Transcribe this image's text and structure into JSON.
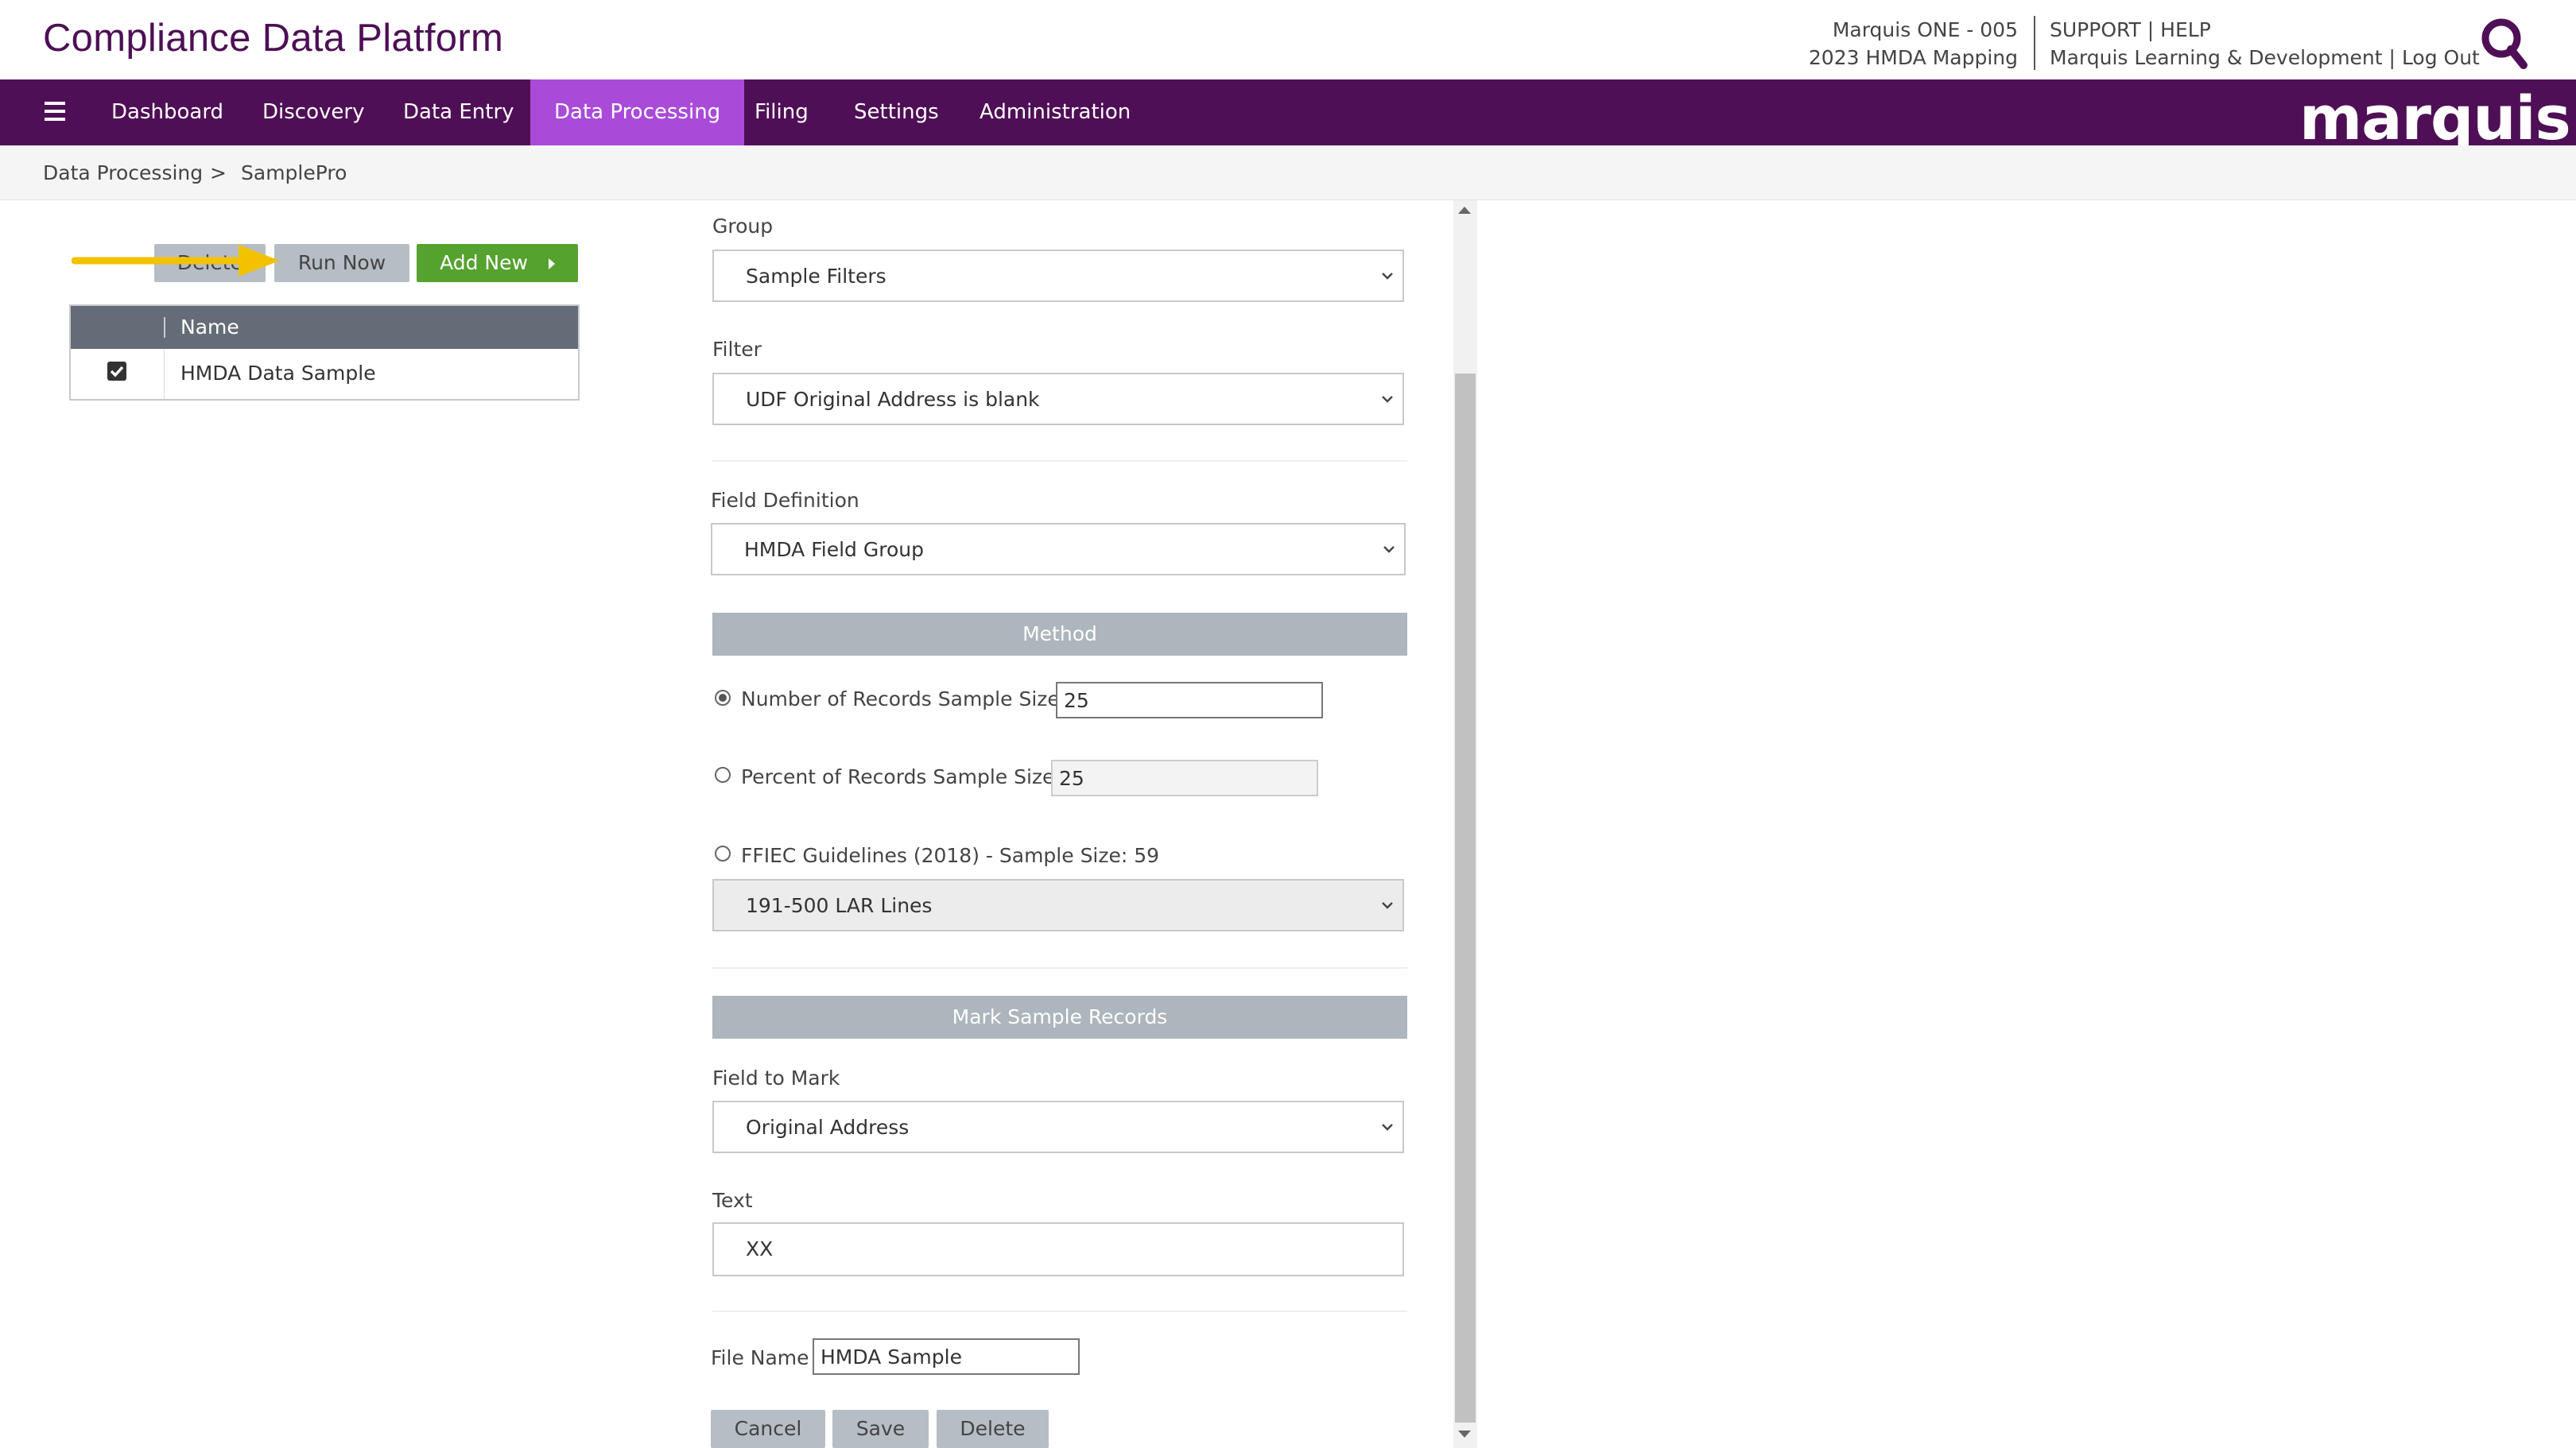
{
  "header": {
    "app_title": "Compliance Data Platform",
    "account_line1": "Marquis ONE - 005",
    "account_line2": "2023 HMDA Mapping",
    "support": "SUPPORT",
    "help": "HELP",
    "org": "Marquis Learning & Development",
    "logout": "Log Out",
    "separator": "|",
    "search_icon": "search-icon"
  },
  "nav": {
    "menu_icon": "hamburger-menu-icon",
    "items": [
      {
        "label": "Dashboard"
      },
      {
        "label": "Discovery"
      },
      {
        "label": "Data Entry"
      },
      {
        "label": "Data Processing"
      },
      {
        "label": "Filing"
      },
      {
        "label": "Settings"
      },
      {
        "label": "Administration"
      }
    ],
    "active_index": 3,
    "brand": "marquis"
  },
  "breadcrumb": {
    "items": [
      "Data Processing",
      "SamplePro"
    ],
    "separator": ">"
  },
  "left_panel": {
    "buttons": {
      "delete": "Delete",
      "run_now": "Run Now",
      "add_new": "Add New"
    },
    "table": {
      "header": "Name",
      "rows": [
        {
          "checked": true,
          "name": "HMDA Data Sample"
        }
      ]
    }
  },
  "form": {
    "group": {
      "label": "Group",
      "value": "Sample Filters"
    },
    "filter": {
      "label": "Filter",
      "value": "UDF Original Address is blank"
    },
    "field_definition": {
      "label": "Field Definition",
      "value": "HMDA Field Group"
    },
    "method": {
      "title": "Method",
      "number_option": {
        "label": "Number of Records Sample Size",
        "value": "25",
        "selected": true
      },
      "percent_option": {
        "label": "Percent of Records Sample Size",
        "value": "25",
        "selected": false
      },
      "ffiec_option": {
        "label": "FFIEC Guidelines (2018) - Sample Size: 59",
        "selected": false
      },
      "ffiec_range": "191-500 LAR Lines"
    },
    "mark": {
      "title": "Mark Sample Records",
      "field_to_mark": {
        "label": "Field to Mark",
        "value": "Original Address"
      },
      "text": {
        "label": "Text",
        "value": "XX"
      }
    },
    "file_name": {
      "label": "File Name",
      "value": "HMDA Sample"
    },
    "buttons": {
      "cancel": "Cancel",
      "save": "Save",
      "delete": "Delete"
    }
  },
  "colors": {
    "brand_purple": "#4f0f56",
    "nav_active": "#a94bd8",
    "add_green": "#55a22e",
    "section_band": "#adb5bd",
    "annotation_arrow": "#f2c200"
  }
}
